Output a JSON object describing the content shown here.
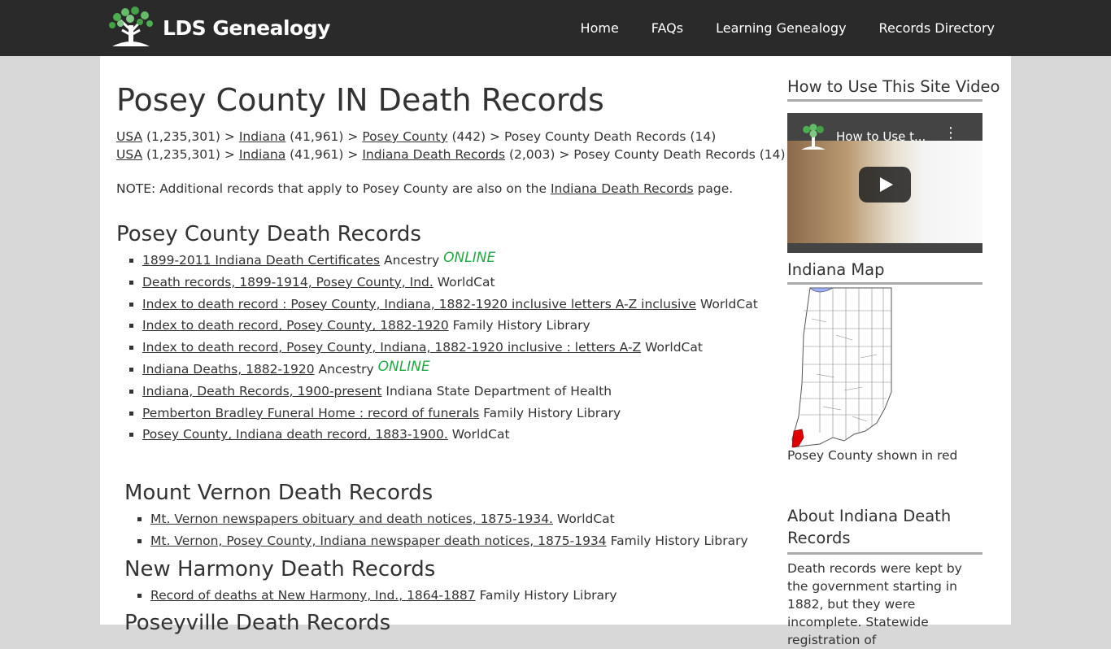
{
  "header": {
    "logo_text": "LDS Genealogy",
    "nav": [
      "Home",
      "FAQs",
      "Learning Genealogy",
      "Records Directory"
    ]
  },
  "page": {
    "title": "Posey County IN Death Records",
    "breadcrumbs": [
      [
        {
          "text": "USA",
          "link": true
        },
        {
          "text": " (1,235,301) > ",
          "link": false
        },
        {
          "text": "Indiana",
          "link": true
        },
        {
          "text": " (41,961) > ",
          "link": false
        },
        {
          "text": "Posey County",
          "link": true
        },
        {
          "text": " (442) > Posey County Death Records (14)",
          "link": false
        }
      ],
      [
        {
          "text": "USA",
          "link": true
        },
        {
          "text": " (1,235,301) > ",
          "link": false
        },
        {
          "text": "Indiana",
          "link": true
        },
        {
          "text": " (41,961) > ",
          "link": false
        },
        {
          "text": "Indiana Death Records",
          "link": true
        },
        {
          "text": " (2,003) > Posey County Death Records (14)",
          "link": false
        }
      ]
    ],
    "note_prefix": "NOTE: Additional records that apply to Posey County are also on the ",
    "note_link": "Indiana Death Records",
    "note_suffix": " page."
  },
  "sections": [
    {
      "heading": "Posey County Death Records",
      "items": [
        {
          "link": "1899-2011 Indiana Death Certificates",
          "source": "Ancestry",
          "online": "ONLINE"
        },
        {
          "link": "Death records, 1899-1914, Posey County, Ind.",
          "source": "WorldCat"
        },
        {
          "link": "Index to death record : Posey County, Indiana, 1882-1920 inclusive letters A-Z inclusive",
          "source": "WorldCat"
        },
        {
          "link": "Index to death record, Posey County, 1882-1920",
          "source": "Family History Library"
        },
        {
          "link": "Index to death record, Posey County, Indiana, 1882-1920 inclusive : letters A-Z",
          "source": "WorldCat"
        },
        {
          "link": "Indiana Deaths, 1882-1920",
          "source": "Ancestry",
          "online": "ONLINE"
        },
        {
          "link": "Indiana, Death Records, 1900-present",
          "source": "Indiana State Department of Health"
        },
        {
          "link": "Pemberton Bradley Funeral Home : record of funerals",
          "source": "Family History Library"
        },
        {
          "link": "Posey County, Indiana death record, 1883-1900.",
          "source": "WorldCat"
        }
      ]
    },
    {
      "heading": "Mount Vernon Death Records",
      "items": [
        {
          "link": "Mt. Vernon newspapers obituary and death notices, 1875-1934.",
          "source": "WorldCat"
        },
        {
          "link": "Mt. Vernon, Posey County, Indiana newspaper death notices, 1875-1934",
          "source": "Family History Library"
        }
      ]
    },
    {
      "heading": "New Harmony Death Records",
      "items": [
        {
          "link": "Record of deaths at New Harmony, Ind., 1864-1887",
          "source": "Family History Library"
        }
      ]
    },
    {
      "heading": "Poseyville Death Records",
      "items": []
    }
  ],
  "sidebar": {
    "video_heading": "How to Use This Site Video",
    "video_title": "How to Use t...",
    "map_heading": "Indiana Map",
    "map_caption": "Posey County shown in red",
    "about_heading": "About Indiana Death Records",
    "about_text": "Death records were kept by the government starting in 1882, but they were incomplete. Statewide registration of"
  },
  "colors": {
    "header_bg": "#2a2a2a",
    "online": "#22aa44",
    "highlight_county": "#e00000"
  }
}
